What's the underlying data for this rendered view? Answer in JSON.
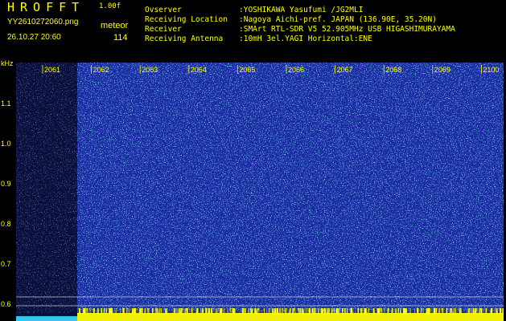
{
  "header": {
    "app_title": "HROFFT",
    "version": "1.00f",
    "filename": "YY2610272060.png",
    "datetime": "26.10.27 20:60",
    "meteor_label": "meteor",
    "meteor_count": "114"
  },
  "info": [
    {
      "key": "Ovserver",
      "value": ":YOSHIKAWA Yasufumi /JG2MLI"
    },
    {
      "key": "Receiving Location",
      "value": ":Nagoya Aichi-pref. JAPAN (136.90E, 35.20N)"
    },
    {
      "key": "Receiver",
      "value": ":SMArt RTL-SDR V5 52.905MHz USB HIGASHIMURAYAMA"
    },
    {
      "key": "Receiving Antenna",
      "value": ":10mH 3el.YAGI Horizontal:ENE"
    }
  ],
  "axis": {
    "unit": "kHz",
    "y_labels": [
      "1.1",
      "1.0",
      "0.9",
      "0.8",
      "0.7",
      "0.6"
    ],
    "x_labels": [
      "2061",
      "2062",
      "2063",
      "2064",
      "2065",
      "2066",
      "2067",
      "2068",
      "2069",
      "2100"
    ]
  },
  "colors": {
    "text": "#ffff00",
    "background": "#000000",
    "spectrum_base": "#1a2aa0",
    "noise": "#38c8ff",
    "dark_band": "#0a0f3a"
  }
}
